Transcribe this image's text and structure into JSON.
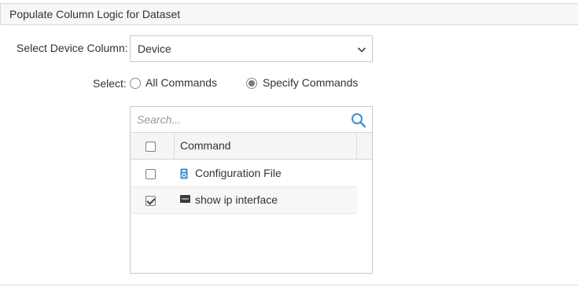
{
  "panel": {
    "title": "Populate Column Logic for Dataset"
  },
  "device_column": {
    "label": "Select Device Column:",
    "selected": "Device"
  },
  "select_mode": {
    "label": "Select:",
    "options": [
      {
        "label": "All Commands",
        "checked": false
      },
      {
        "label": "Specify Commands",
        "checked": true
      }
    ]
  },
  "commands": {
    "search_placeholder": "Search...",
    "header": {
      "column": "Command",
      "all_checked": false
    },
    "rows": [
      {
        "label": "Configuration File",
        "icon": "configuration-file-icon",
        "checked": false
      },
      {
        "label": "show ip interface",
        "icon": "cli-icon",
        "checked": true
      }
    ]
  },
  "colors": {
    "accent_blue": "#3d8fd6",
    "header_bg": "#f7f7f7",
    "border": "#c9c9c9"
  }
}
